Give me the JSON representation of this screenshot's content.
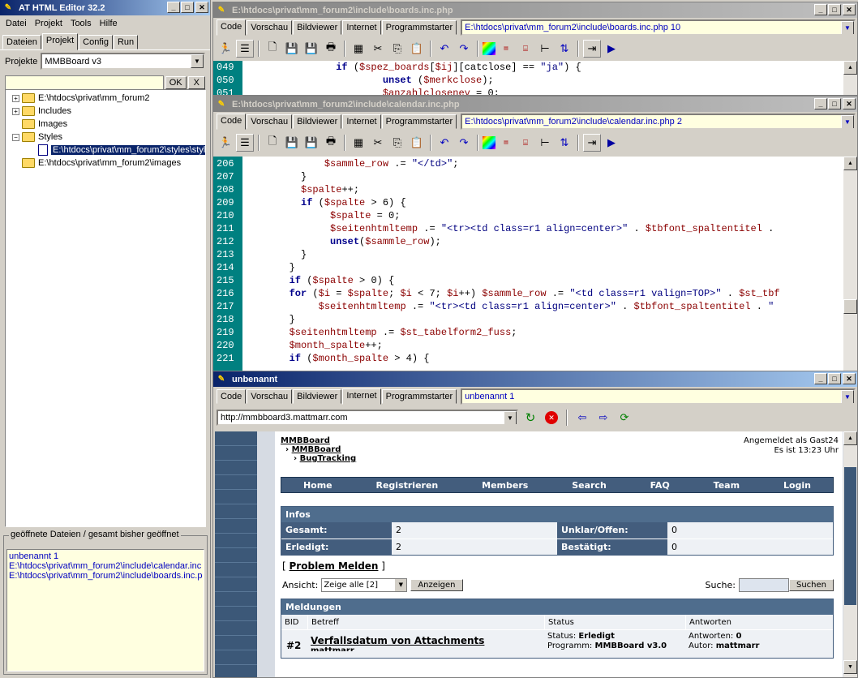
{
  "app": {
    "title": "AT HTML Editor 32.2",
    "accent": "#0a246a"
  },
  "menu": [
    "Datei",
    "Projekt",
    "Tools",
    "Hilfe"
  ],
  "left_tabs": [
    "Dateien",
    "Projekt",
    "Config",
    "Run"
  ],
  "projects": {
    "label": "Projekte",
    "selected": "MMBBoard v3"
  },
  "filter": {
    "value": "",
    "ok": "OK",
    "clear": "X"
  },
  "tree": [
    {
      "label": "E:\\htdocs\\privat\\mm_forum2",
      "type": "folder",
      "expander": "+",
      "level": 0
    },
    {
      "label": "Includes",
      "type": "folder",
      "expander": "+",
      "level": 0
    },
    {
      "label": "Images",
      "type": "folder",
      "expander": "",
      "level": 0
    },
    {
      "label": "Styles",
      "type": "folder",
      "expander": "−",
      "level": 0
    },
    {
      "label": "E:\\htdocs\\privat\\mm_forum2\\styles\\style",
      "type": "file",
      "expander": "",
      "level": 1,
      "selected": true
    },
    {
      "label": "E:\\htdocs\\privat\\mm_forum2\\images",
      "type": "folder",
      "expander": "",
      "level": 0
    }
  ],
  "opened": {
    "title": "geöffnete Dateien / gesamt bisher geöffnet",
    "items": [
      "unbenannt 1",
      "E:\\htdocs\\privat\\mm_forum2\\include\\calendar.inc",
      "E:\\htdocs\\privat\\mm_forum2\\include\\boards.inc.p"
    ]
  },
  "editor_tabs": [
    "Code",
    "Vorschau",
    "Bildviewer",
    "Internet",
    "Programmstarter"
  ],
  "win1": {
    "title": "E:\\htdocs\\privat\\mm_forum2\\include\\boards.inc.php",
    "combo": "E:\\htdocs\\privat\\mm_forum2\\include\\boards.inc.php 10",
    "lines": [
      {
        "n": "049",
        "html": "                <span class='kw'>if</span> (<span class='var'>$spez_boards</span>[<span class='var'>$ij</span>][catclose] == <span class='str'>\"ja\"</span>) {"
      },
      {
        "n": "050",
        "html": "                        <span class='kw'>unset</span> (<span class='var'>$merkclose</span>);"
      },
      {
        "n": "051",
        "html": "                        <span class='var'>$anzahlcloseney</span> = 0;"
      }
    ]
  },
  "win2": {
    "title": "E:\\htdocs\\privat\\mm_forum2\\include\\calendar.inc.php",
    "combo": "E:\\htdocs\\privat\\mm_forum2\\include\\calendar.inc.php 2",
    "lines": [
      {
        "n": "206",
        "html": "              <span class='var'>$sammle_row</span> .= <span class='str'>\"&lt;/td&gt;\"</span>;"
      },
      {
        "n": "207",
        "html": "          }"
      },
      {
        "n": "208",
        "html": "          <span class='var'>$spalte</span>++;"
      },
      {
        "n": "209",
        "html": "          <span class='kw'>if</span> (<span class='var'>$spalte</span> &gt; 6) {"
      },
      {
        "n": "210",
        "html": "               <span class='var'>$spalte</span> = 0;"
      },
      {
        "n": "211",
        "html": "               <span class='var'>$seitenhtmltemp</span> .= <span class='str'>\"&lt;tr&gt;&lt;td class=r1 align=center&gt;\"</span> . <span class='var'>$tbfont_spaltentitel</span> ."
      },
      {
        "n": "212",
        "html": "               <span class='kw'>unset</span>(<span class='var'>$sammle_row</span>);"
      },
      {
        "n": "213",
        "html": "          }"
      },
      {
        "n": "214",
        "html": "        }"
      },
      {
        "n": "215",
        "html": "        <span class='kw'>if</span> (<span class='var'>$spalte</span> &gt; 0) {"
      },
      {
        "n": "216",
        "html": "        <span class='kw'>for</span> (<span class='var'>$i</span> = <span class='var'>$spalte</span>; <span class='var'>$i</span> &lt; 7; <span class='var'>$i</span>++) <span class='var'>$sammle_row</span> .= <span class='str'>\"&lt;td class=r1 valign=TOP&gt;\"</span> . <span class='var'>$st_tbf</span>"
      },
      {
        "n": "217",
        "html": "             <span class='var'>$seitenhtmltemp</span> .= <span class='str'>\"&lt;tr&gt;&lt;td class=r1 align=center&gt;\"</span> . <span class='var'>$tbfont_spaltentitel</span> . <span class='str'>\"</span>"
      },
      {
        "n": "218",
        "html": "        }"
      },
      {
        "n": "219",
        "html": "        <span class='var'>$seitenhtmltemp</span> .= <span class='var'>$st_tabelform2_fuss</span>;"
      },
      {
        "n": "220",
        "html": "        <span class='var'>$month_spalte</span>++;"
      },
      {
        "n": "221",
        "html": "        <span class='kw'>if</span> (<span class='var'>$month_spalte</span> &gt; 4) {"
      }
    ]
  },
  "win3": {
    "title": "unbenannt",
    "combo": "unbenannt 1",
    "url": "http://mmbboard3.mattmarr.com"
  },
  "web": {
    "crumbs": [
      "MMBBoard",
      "MMBBoard",
      "BugTracking"
    ],
    "login_status": "Angemeldet als Gast24",
    "time": "Es ist 13:23 Uhr",
    "nav": [
      "Home",
      "Registrieren",
      "Members",
      "Search",
      "FAQ",
      "Team",
      "Login"
    ],
    "infos_title": "Infos",
    "infos": [
      {
        "l1": "Gesamt:",
        "v1": "2",
        "l2": "Unklar/Offen:",
        "v2": "0"
      },
      {
        "l1": "Erledigt:",
        "v1": "2",
        "l2": "Bestätigt:",
        "v2": "0"
      }
    ],
    "report_link": "Problem Melden",
    "bracket_open": "[",
    "bracket_close": "]",
    "ansicht_label": "Ansicht:",
    "ansicht_value": "Zeige alle [2]",
    "anzeigen": "Anzeigen",
    "suche_label": "Suche:",
    "suchen": "Suchen",
    "meldungen_title": "Meldungen",
    "columns": [
      "BID",
      "Betreff",
      "Status",
      "Antworten"
    ],
    "rows": [
      {
        "bid": "#2",
        "subject": "Verfallsdatum von Attachments",
        "author_small": "mattmarr",
        "status_label": "Status:",
        "status": "Erledigt",
        "programm_label": "Programm:",
        "programm": "MMBBoard v3.0",
        "antworten_label": "Antworten:",
        "antworten": "0",
        "autor_label": "Autor:",
        "autor": "mattmarr"
      }
    ]
  }
}
